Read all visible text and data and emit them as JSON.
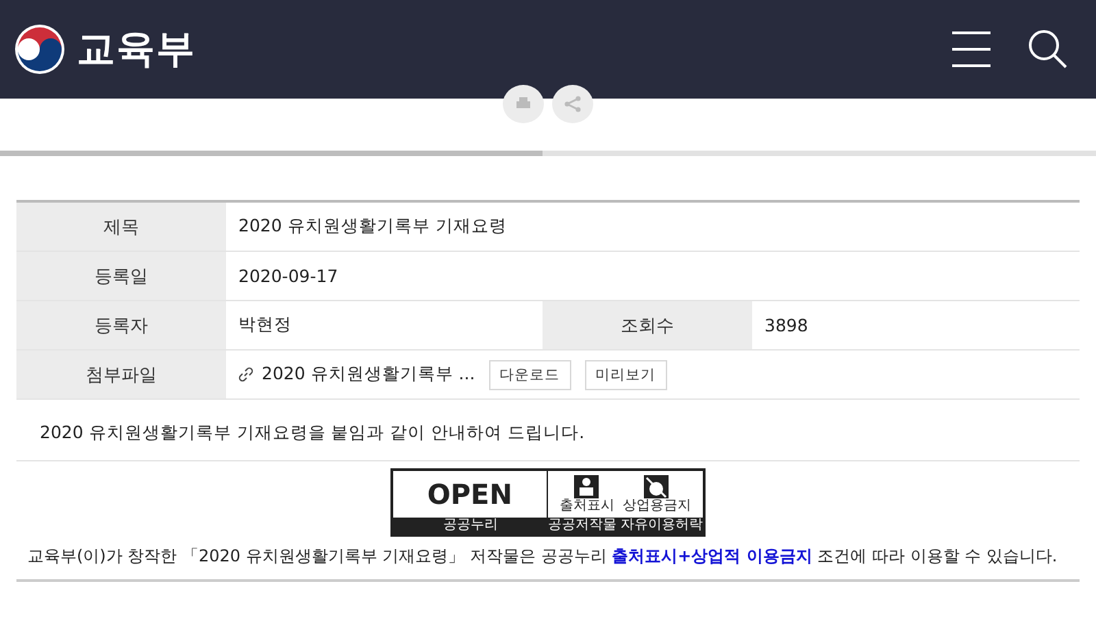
{
  "header": {
    "logo_text": "교육부"
  },
  "page_progress": {
    "level": 0.495
  },
  "info_table": {
    "rows": [
      {
        "kind": "single",
        "label": "제목",
        "value": "2020 유치원생활기록부 기재요령"
      },
      {
        "kind": "single",
        "label": "등록일",
        "value": "2020-09-17"
      },
      {
        "kind": "double",
        "label": "등록자",
        "value": "박현정",
        "label_2": "조회수",
        "value_2": "3898"
      },
      {
        "kind": "file",
        "label": "첨부파일",
        "value": "2020 유치원생활기록부 ...",
        "buttons": [
          "다운로드",
          "미리보기"
        ]
      }
    ]
  },
  "body_text": "2020 유치원생활기록부 기재요령을 붙임과 같이 안내하여 드립니다.",
  "license_badge": {
    "title": "OPEN",
    "caption": "공공누리",
    "icons": [
      {
        "kind": "attribution",
        "label": "출처표시"
      },
      {
        "kind": "noncommercial",
        "label": "상업용금지"
      }
    ],
    "caption_2": "공공저작물 자유이용허락"
  },
  "license_text": "교육부(이)가 창작한 「2020 유치원생활기록부 기재요령」 저작물은 공공누리 **출처표시+상업적 이용금지** 조건에 따라 이용할 수 있습니다."
}
